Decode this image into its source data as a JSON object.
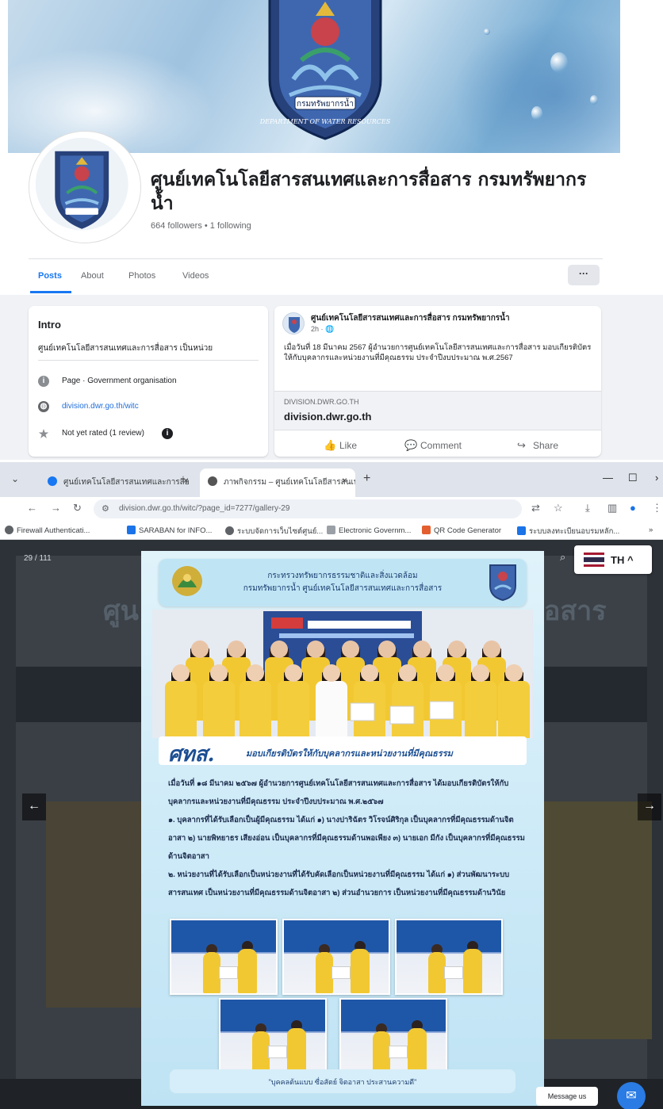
{
  "facebook": {
    "cover_emblem_caption": "DEPARTMENT OF WATER RESOURCES",
    "cover_emblem_banner": "กรมทรัพยากรน้ำ",
    "page_name": "ศูนย์เทคโนโลยีสารสนเทศและการสื่อสาร กรมทรัพยากรน้ำ",
    "followers": "664 followers • 1 following",
    "tabs": [
      "Posts",
      "About",
      "Photos",
      "Videos"
    ],
    "more_label": "···",
    "intro": {
      "title": "Intro",
      "description": "ศูนย์เทคโนโลยีสารสนเทศและการสื่อสาร เป็นหน่วย",
      "category": "Page · Government organisation",
      "website": "division.dwr.go.th/witc",
      "rating": "Not yet rated (1 review)"
    },
    "post": {
      "author": "ศูนย์เทคโนโลยีสารสนเทศและการสื่อสาร กรมทรัพยากรน้ำ",
      "time": "2h · 🌐",
      "text": "เมื่อวันที่ 18 มีนาคม 2567 ผู้อำนวยการศูนย์เทคโนโลยีสารสนเทศและการสื่อสาร มอบเกียรติบัตรให้กับบุคลากรและหน่วยงานที่มีคุณธรรม ประจำปีงบประมาณ พ.ศ.2567",
      "link_domain": "DIVISION.DWR.GO.TH",
      "link_title": "division.dwr.go.th",
      "actions": [
        "Like",
        "Comment",
        "Share"
      ]
    }
  },
  "browser": {
    "tabs": [
      {
        "title": "ศูนย์เทคโนโลยีสารสนเทศและการสื่อ",
        "favicon_color": "#1877f2"
      },
      {
        "title": "ภาพกิจกรรม – ศูนย์เทคโนโลยีสารสนเทศ",
        "favicon_color": "#555555"
      }
    ],
    "tab_close": "×",
    "new_tab": "+",
    "url": "division.dwr.go.th/witc/?page_id=7277/gallery-29",
    "bookmarks": [
      {
        "label": "Firewall Authenticati...",
        "color": "#5f6368"
      },
      {
        "label": "SARABAN for INFO...",
        "color": "#1a73e8"
      },
      {
        "label": "ระบบจัดการเว็บไซต์ศูนย์...",
        "color": "#5f6368"
      },
      {
        "label": "Electronic Governm...",
        "color": "#9aa0a6"
      },
      {
        "label": "QR Code Generator",
        "color": "#e35f2f"
      },
      {
        "label": "ระบบลงทะเบียนอบรมหลัก...",
        "color": "#1a73e8"
      }
    ],
    "bookmarks_more": "»"
  },
  "site": {
    "title_left": "ศูน",
    "title_right": "อสาร",
    "gallery_counter": "29 / 111",
    "lang_code": "TH",
    "message_us": "Message us"
  },
  "poster": {
    "head_line1": "กระทรวงทรัพยากรธรรมชาติและสิ่งแวดล้อม",
    "head_line2": "กรมทรัพยากรน้ำ ศูนย์เทคโนโลยีสารสนเทศและการสื่อสาร",
    "title_main": "ศทส.",
    "title_sub": "มอบเกียรติบัตรให้กับบุคลากรและหน่วยงานที่มีคุณธรรม",
    "para1": "เมื่อวันที่ ๑๘ มีนาคม ๒๕๖๗ ผู้อำนวยการศูนย์เทคโนโลยีสารสนเทศและการสื่อสาร ได้มอบเกียรติบัตรให้กับบุคลากรและหน่วยงานที่มีคุณธรรม ประจำปีงบประมาณ พ.ศ.๒๕๖๗",
    "para2": "๑. บุคลากรที่ได้รับเลือกเป็นผู้มีคุณธรรม ได้แก่ ๑) นางปาริฉัตร วิโรจน์ศิริกุล เป็นบุคลากรที่มีคุณธรรมด้านจิตอาสา ๒) นายพิทยาธร เสียงอ่อน เป็นบุคลากรที่มีคุณธรรมด้านพอเพียง ๓) นายเอก มีกัง เป็นบุคลากรที่มีคุณธรรมด้านจิตอาสา",
    "para3": "๒. หน่วยงานที่ได้รับเลือกเป็นหน่วยงานที่ได้รับคัดเลือกเป็นหน่วยงานที่มีคุณธรรม ได้แก่ ๑) ส่วนพัฒนาระบบสารสนเทศ เป็นหน่วยงานที่มีคุณธรรมด้านจิตอาสา ๒) ส่วนอำนวยการ เป็นหน่วยงานที่มีคุณธรรมด้านวินัย",
    "footer": "\"บุคคลต้นแบบ ซื่อสัตย์ จิตอาสา ประสานความดี\""
  },
  "colors": {
    "facebook_blue": "#1877f2",
    "poster_title_blue": "#1c4f93",
    "uniform_yellow": "#f2c832"
  },
  "icons": {
    "page_info": "info-icon",
    "website": "globe-icon",
    "rating": "star-icon",
    "like": "thumbs-up-icon",
    "comment": "comment-icon",
    "share": "share-icon",
    "chat": "messenger-icon"
  }
}
